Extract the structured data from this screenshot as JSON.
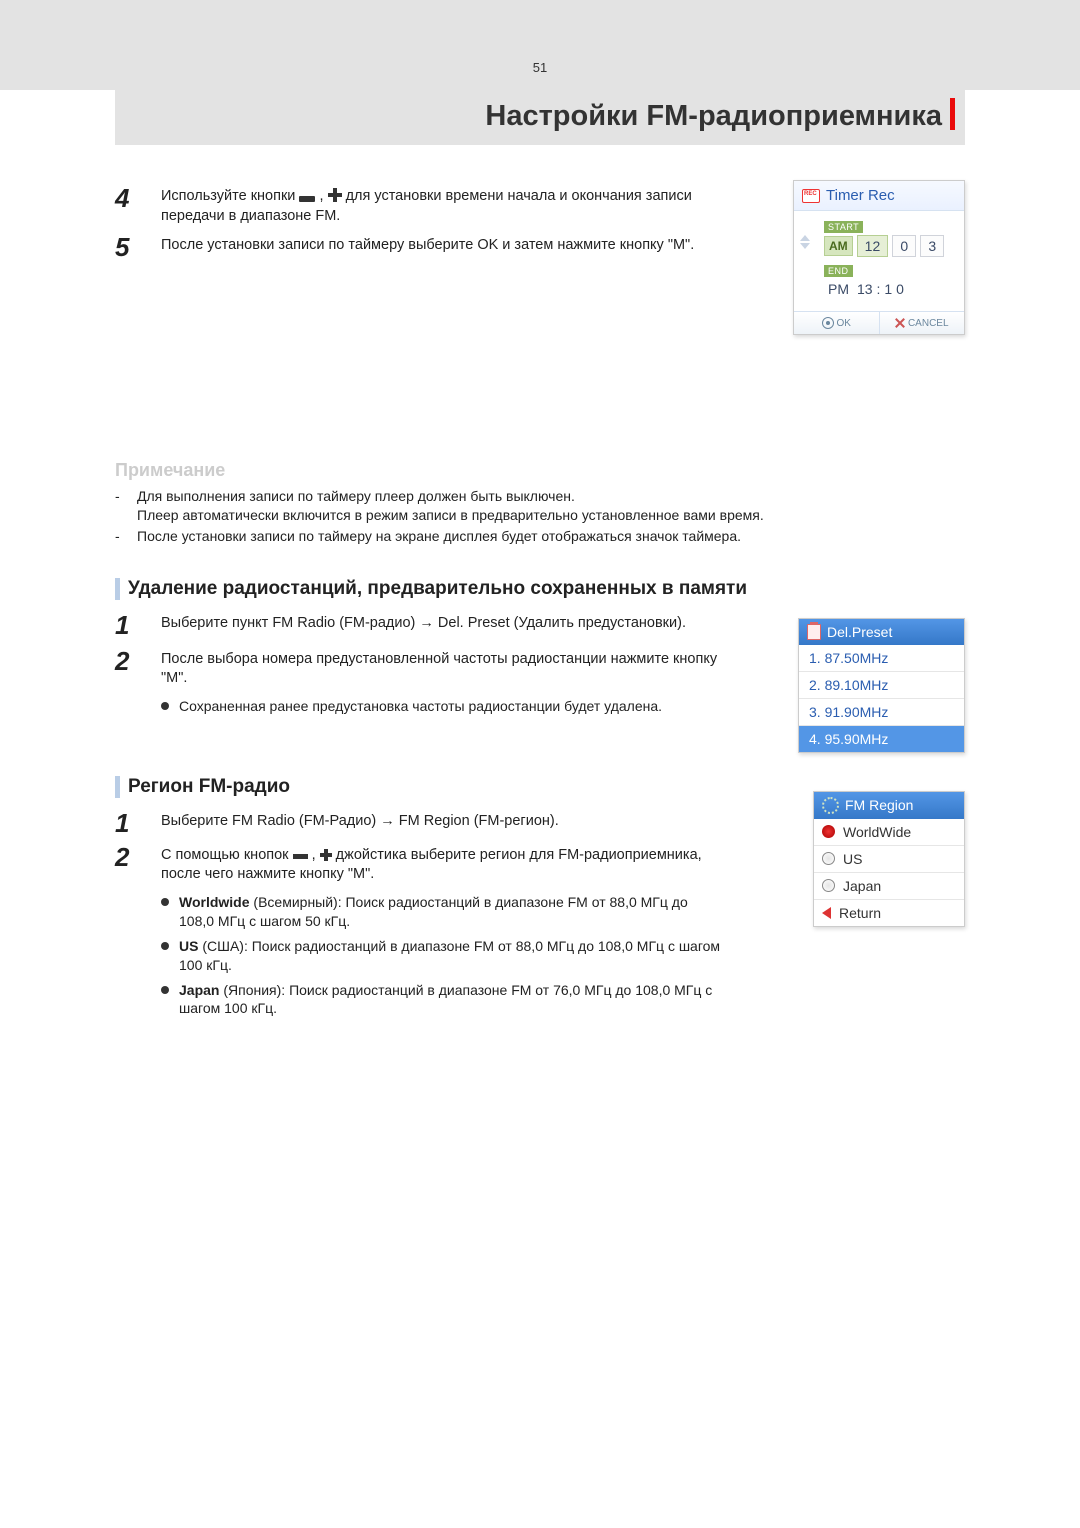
{
  "page_number": "51",
  "header_title": "Настройки FM-радиоприемника",
  "steps_a": {
    "4": {
      "part1": "Используйте кнопки ",
      "part2": " , ",
      "part3": " для установки времени начала и окончания записи передачи в диапазоне FM."
    },
    "5": "После установки записи по таймеру выберите OK и затем нажмите кнопку \"M\"."
  },
  "timer_rec": {
    "title": "Timer Rec",
    "start_label": "START",
    "end_label": "END",
    "start_ampm": "AM",
    "start_h": "12",
    "start_m1": "0",
    "start_m2": "3",
    "end_ampm": "PM",
    "end_h": "13 :",
    "end_m1": "1",
    "end_m2": "0",
    "ok": "OK",
    "cancel": "CANCEL"
  },
  "note": {
    "title": "Примечание",
    "items": [
      "Для выполнения записи по таймеру плеер должен быть выключен.\nПлеер автоматически включится в режим записи в предварительно установленное вами время.",
      "После установки записи по таймеру на экране дисплея будет отображаться значок таймера."
    ]
  },
  "del_section": {
    "title": "Удаление радиостанций, предварительно сохраненных в памяти",
    "step1": "Выберите пункт FM Radio (FM-радио) → Del. Preset (Удалить предустановки).",
    "step2": "После выбора номера предустановленной частоты радиостанции нажмите кнопку \"M\".",
    "bullet": "Сохраненная ранее предустановка частоты радиостанции будет удалена."
  },
  "del_preset_box": {
    "title": "Del.Preset",
    "rows": [
      "1.  87.50MHz",
      "2.  89.10MHz",
      "3.  91.90MHz",
      "4.  95.90MHz"
    ]
  },
  "region_section": {
    "title": "Регион FM-радио",
    "step1": "Выберите FM Radio (FM-Радио) → FM Region (FM-регион).",
    "step2_a": "С помощью кнопок ",
    "step2_b": ", ",
    "step2_c": " джойстика выберите регион для FM-радиоприемника, после чего нажмите кнопку \"M\".",
    "b_ww_label": "Worldwide",
    "b_ww": " (Всемирный): Поиск радиостанций в диапазоне FM от 88,0 МГц до 108,0 МГц с шагом 50 кГц.",
    "b_us_label": "US",
    "b_us": " (США): Поиск радиостанций в диапазоне FM от 88,0 МГц до 108,0 МГц с шагом 100 кГц.",
    "b_jp_label": "Japan",
    "b_jp": " (Япония): Поиск радиостанций в диапазоне FM от 76,0 МГц до 108,0 МГц с шагом 100 кГц."
  },
  "region_box": {
    "title": "FM Region",
    "rows": [
      "WorldWide",
      "US",
      "Japan",
      "Return"
    ]
  }
}
